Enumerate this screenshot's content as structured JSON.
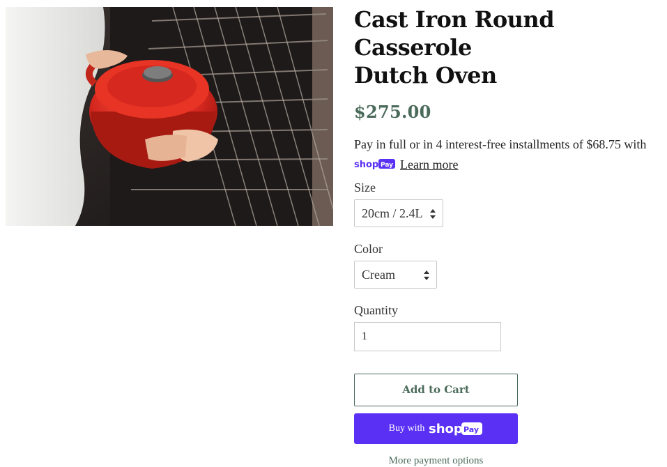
{
  "product": {
    "title_line1": "Cast Iron Round Casserole",
    "title_line2": "Dutch Oven",
    "price": "$275.00",
    "installments_text": "Pay in full or in 4 interest-free installments of $68.75 with",
    "shoppay_badge": "shop Pay",
    "learn_more": "Learn more"
  },
  "options": {
    "size_label": "Size",
    "size_value": "20cm / 2.4L",
    "color_label": "Color",
    "color_value": "Cream",
    "quantity_label": "Quantity",
    "quantity_value": "1"
  },
  "actions": {
    "add_to_cart": "Add to Cart",
    "buy_with": "Buy with",
    "buy_brand": "shop Pay",
    "more_payment_options": "More payment options"
  },
  "colors": {
    "accent": "#4a6a5a",
    "shoppay": "#5a31f4",
    "pot_red": "#d6281f"
  }
}
